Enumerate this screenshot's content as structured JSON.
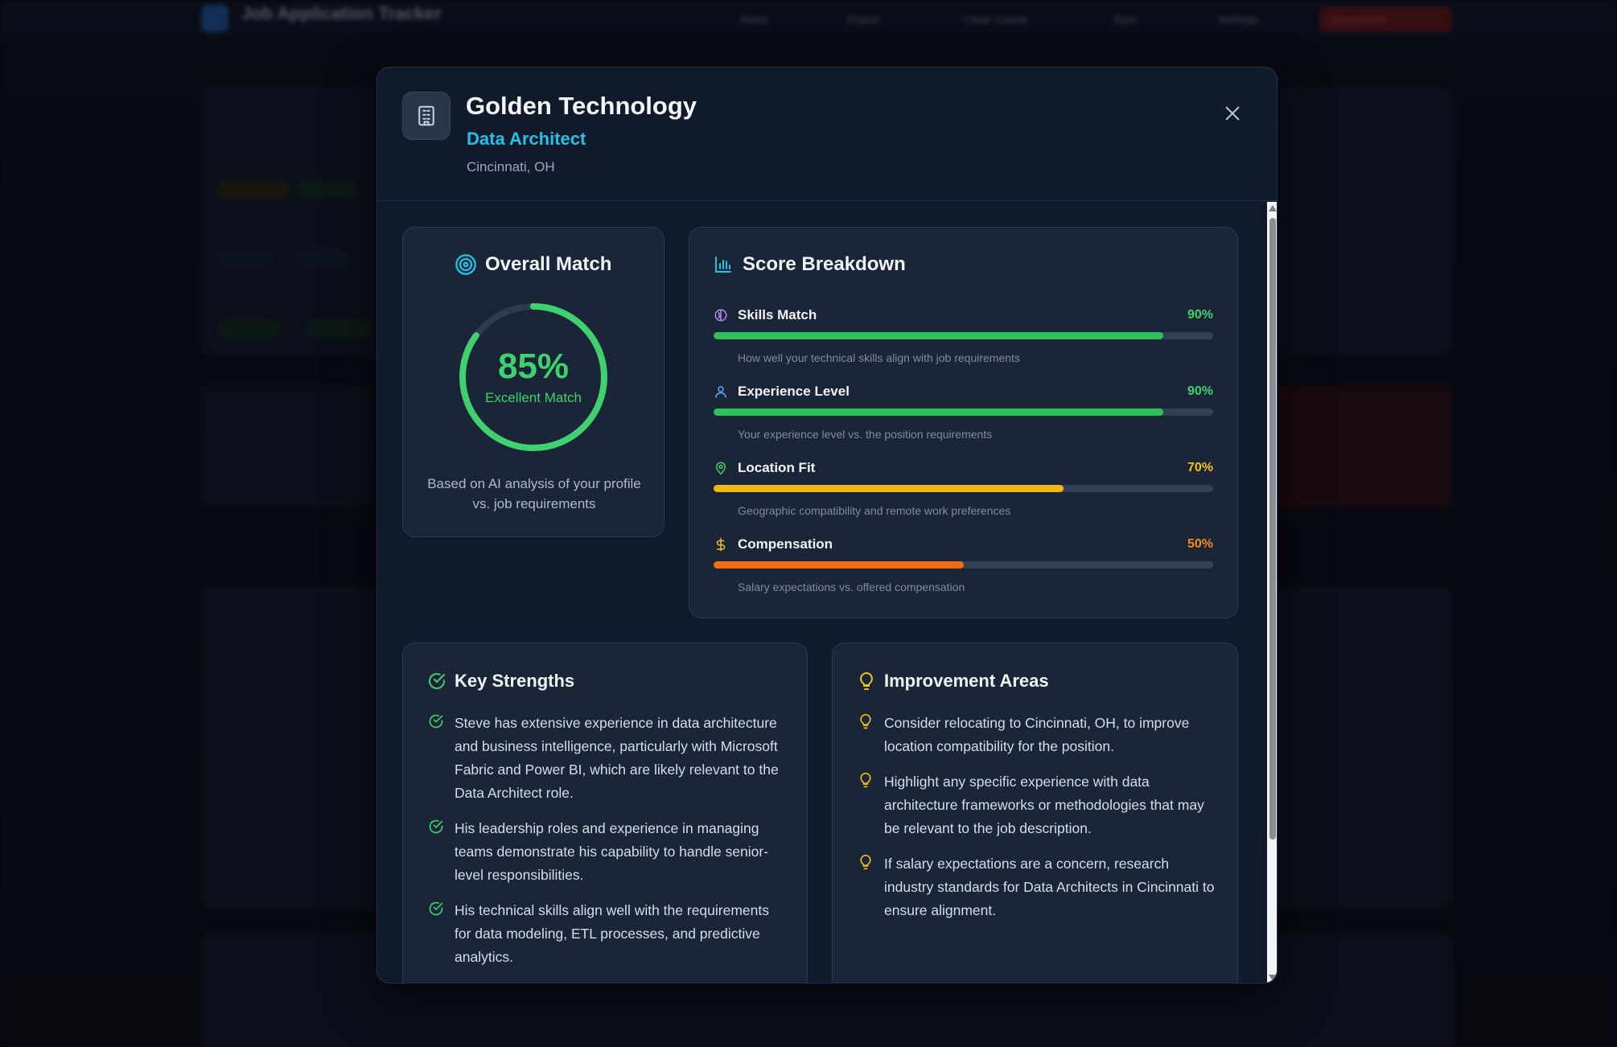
{
  "background": {
    "app_title": "Job Application Tracker",
    "nav": [
      "Alerts",
      "Export",
      "Clear Cache",
      "Sync",
      "Settings",
      "Disconnect"
    ]
  },
  "modal": {
    "company": "Golden Technology",
    "role": "Data Architect",
    "location": "Cincinnati, OH",
    "close_icon": "close-icon"
  },
  "overall": {
    "title": "Overall Match",
    "score": 85,
    "score_label": "85%",
    "rating": "Excellent Match",
    "note": "Based on AI analysis of your profile vs. job requirements",
    "color": "#3fd16f"
  },
  "breakdown": {
    "title": "Score Breakdown",
    "metrics": [
      {
        "name": "Skills Match",
        "value": 90,
        "label": "90%",
        "desc": "How well your technical skills align with job requirements",
        "color": "#2fbf5b",
        "text_color": "#3fd16f",
        "icon": "brain-icon",
        "icon_color": "#b48cf0"
      },
      {
        "name": "Experience Level",
        "value": 90,
        "label": "90%",
        "desc": "Your experience level vs. the position requirements",
        "color": "#2fbf5b",
        "text_color": "#3fd16f",
        "icon": "user-icon",
        "icon_color": "#5aa8f5"
      },
      {
        "name": "Location Fit",
        "value": 70,
        "label": "70%",
        "desc": "Geographic compatibility and remote work preferences",
        "color": "#f2b712",
        "text_color": "#f2c21a",
        "icon": "map-pin-icon",
        "icon_color": "#3fd16f"
      },
      {
        "name": "Compensation",
        "value": 50,
        "label": "50%",
        "desc": "Salary expectations vs. offered compensation",
        "color": "#f26d12",
        "text_color": "#f28a1a",
        "icon": "dollar-icon",
        "icon_color": "#f2c21a"
      }
    ]
  },
  "strengths": {
    "title": "Key Strengths",
    "items": [
      "Steve has extensive experience in data architecture and business intelligence, particularly with Microsoft Fabric and Power BI, which are likely relevant to the Data Architect role.",
      "His leadership roles and experience in managing teams demonstrate his capability to handle senior-level responsibilities.",
      "His technical skills align well with the requirements for data modeling, ETL processes, and predictive analytics."
    ]
  },
  "improvements": {
    "title": "Improvement Areas",
    "items": [
      "Consider relocating to Cincinnati, OH, to improve location compatibility for the position.",
      "Highlight any specific experience with data architecture frameworks or methodologies that may be relevant to the job description.",
      "If salary expectations are a concern, research industry standards for Data Architects in Cincinnati to ensure alignment."
    ]
  }
}
